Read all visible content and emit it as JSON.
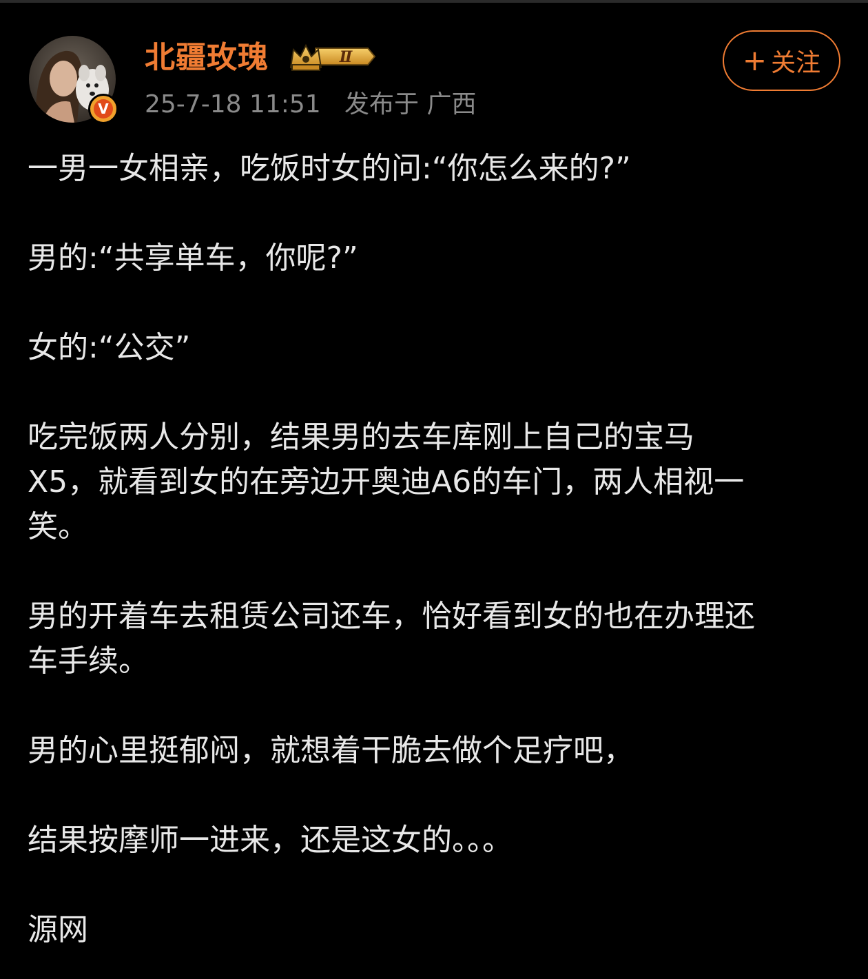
{
  "post": {
    "author": {
      "name": "北疆玫瑰",
      "verified_badge": "V",
      "rank_badge": "Ⅱ",
      "avatar_icon": "user-avatar-photo"
    },
    "meta": {
      "timestamp": "25-7-18 11:51",
      "location": "发布于 广西"
    },
    "follow_button": {
      "label": "关注",
      "icon": "plus-icon"
    },
    "paragraphs": [
      "一男一女相亲，吃饭时女的问:“你怎么来的?”",
      "男的:“共享单车，你呢?”",
      "女的:“公交”",
      "吃完饭两人分别，结果男的去车库刚上自己的宝马\nX5，就看到女的在旁边开奥迪A6的车门，两人相视一\n笑。",
      "男的开着车去租赁公司还车，恰好看到女的也在办理还\n车手续。",
      "男的心里挺郁闷，就想着干脆去做个足疗吧，",
      "结果按摩师一进来，还是这女的。。。",
      "源网"
    ]
  },
  "colors": {
    "background": "#000000",
    "accent": "#f07c33",
    "meta_text": "#8a8a8a",
    "body_text": "#e8e8e8"
  }
}
